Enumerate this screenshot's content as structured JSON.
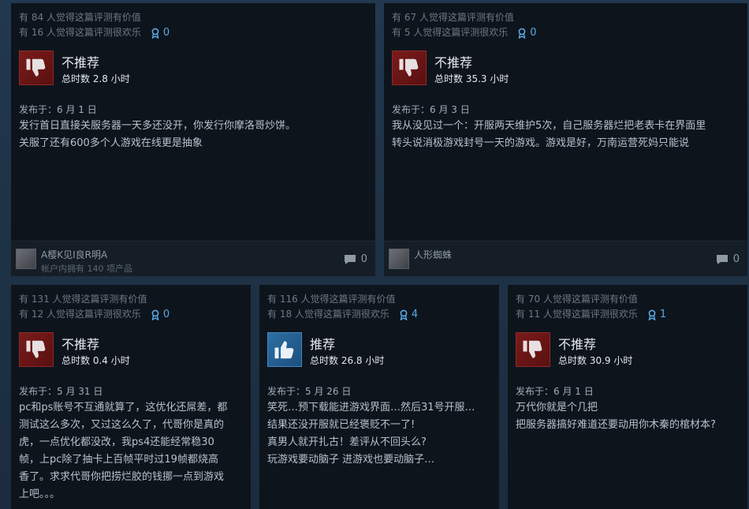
{
  "reviews": [
    {
      "helpful_text": "有 84 人觉得这篇评测有价值",
      "funny_text": "有 16 人觉得这篇评测很欢乐",
      "award_count": "0",
      "verdict": "不推荐",
      "hours": "总时数 2.8 小时",
      "posted": "发布于：6 月 1 日",
      "lines": [
        "发行首日直接关服务器一天多还没开，你发行你摩洛哥炒饼。",
        "关服了还有600多个人游戏在线更是抽象"
      ],
      "author": "A樱K见I良R明A",
      "owns": "帐户内拥有 140 项产品",
      "comment_count": "0",
      "icon": "thumbs-down-icon"
    },
    {
      "helpful_text": "有 67 人觉得这篇评测有价值",
      "funny_text": "有 5 人觉得这篇评测很欢乐",
      "award_count": "0",
      "verdict": "不推荐",
      "hours": "总时数 35.3 小时",
      "posted": "发布于：6 月 3 日",
      "lines": [
        "我从没见过一个：开服两天维护5次，自己服务器烂把老表卡在界面里",
        "转头说消极游戏封号一天的游戏。游戏是好，万南运营死妈只能说"
      ],
      "author": "人形蜘蛛",
      "comment_count": "0",
      "icon": "thumbs-down-icon"
    },
    {
      "helpful_text": "有 131 人觉得这篇评测有价值",
      "funny_text": "有 12 人觉得这篇评测很欢乐",
      "award_count": "0",
      "verdict": "不推荐",
      "hours": "总时数 0.4 小时",
      "posted": "发布于：5 月 31 日",
      "lines": [
        "pc和ps账号不互通就算了，这优化还屌差，都",
        "测试这么多次，又过这么久了，代哥你是真的",
        "虎，一点优化都没改，我ps4还能经常稳30",
        "帧，上pc除了抽卡上百帧平时过19帧都烧高",
        "香了。求求代哥你把捞烂胶的钱挪一点到游戏",
        "上吧。。。"
      ],
      "icon": "thumbs-down-icon"
    },
    {
      "helpful_text": "有 116 人觉得这篇评测有价值",
      "funny_text": "有 18 人觉得这篇评测很欢乐",
      "award_count": "4",
      "verdict": "推荐",
      "hours": "总时数 26.8 小时",
      "posted": "发布于：5 月 26 日",
      "lines": [
        "笑死…预下载能进游戏界面…然后31号开服…",
        "结果还没开服就已经褒贬不一了!",
        "真男人就开扎古！差评从不回头么?",
        "玩游戏要动脑子 进游戏也要动脑子…"
      ],
      "icon": "thumbs-up-icon"
    },
    {
      "helpful_text": "有 70 人觉得这篇评测有价值",
      "funny_text": "有 11 人觉得这篇评测很欢乐",
      "award_count": "1",
      "verdict": "不推荐",
      "hours": "总时数 30.9 小时",
      "posted": "发布于：6 月 1 日",
      "lines": [
        "万代你就是个几把",
        "把服务器搞好难道还要动用你木秦的棺材本?"
      ],
      "icon": "thumbs-down-icon"
    }
  ]
}
